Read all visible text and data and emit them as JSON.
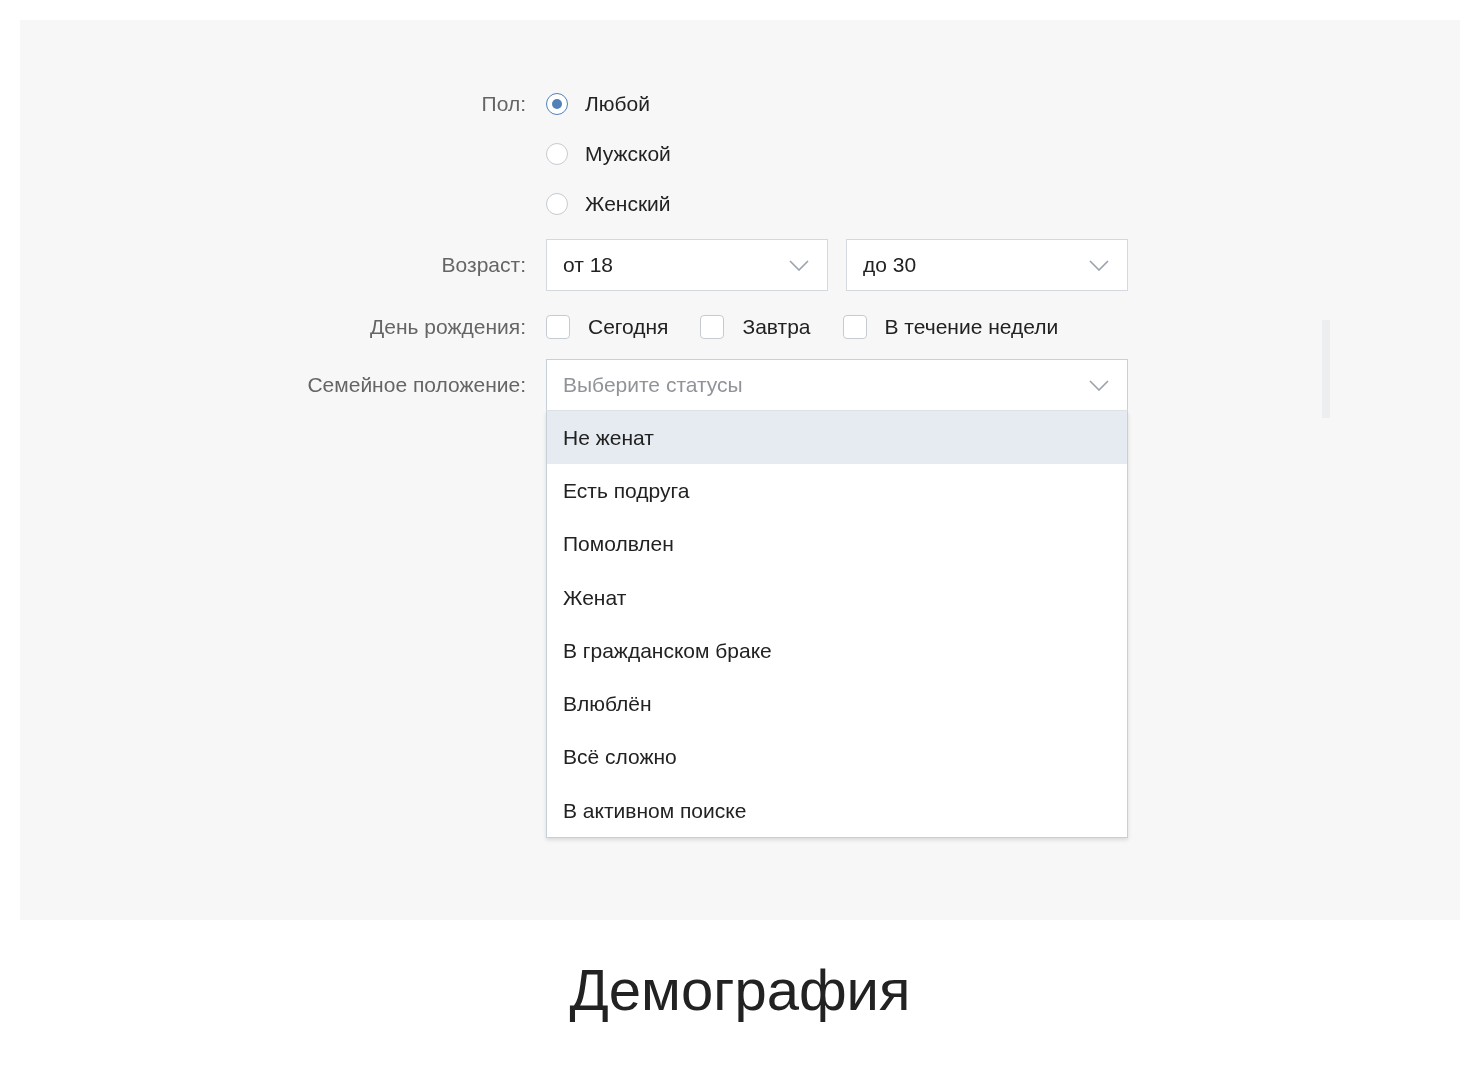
{
  "gender": {
    "label": "Пол:",
    "options": [
      {
        "label": "Любой",
        "selected": true
      },
      {
        "label": "Мужской",
        "selected": false
      },
      {
        "label": "Женский",
        "selected": false
      }
    ]
  },
  "age": {
    "label": "Возраст:",
    "from": {
      "value": "от 18"
    },
    "to": {
      "value": "до 30"
    }
  },
  "birthday": {
    "label": "День рождения:",
    "options": [
      {
        "label": "Сегодня",
        "checked": false
      },
      {
        "label": "Завтра",
        "checked": false
      },
      {
        "label": "В течение недели",
        "checked": false
      }
    ]
  },
  "marital": {
    "label": "Семейное положение:",
    "placeholder": "Выберите статусы",
    "expanded": true,
    "options": [
      {
        "label": "Не женат",
        "highlighted": true
      },
      {
        "label": "Есть подруга",
        "highlighted": false
      },
      {
        "label": "Помолвлен",
        "highlighted": false
      },
      {
        "label": "Женат",
        "highlighted": false
      },
      {
        "label": "В гражданском браке",
        "highlighted": false
      },
      {
        "label": "Влюблён",
        "highlighted": false
      },
      {
        "label": "Всё сложно",
        "highlighted": false
      },
      {
        "label": "В активном поиске",
        "highlighted": false
      }
    ]
  },
  "caption": "Демография"
}
